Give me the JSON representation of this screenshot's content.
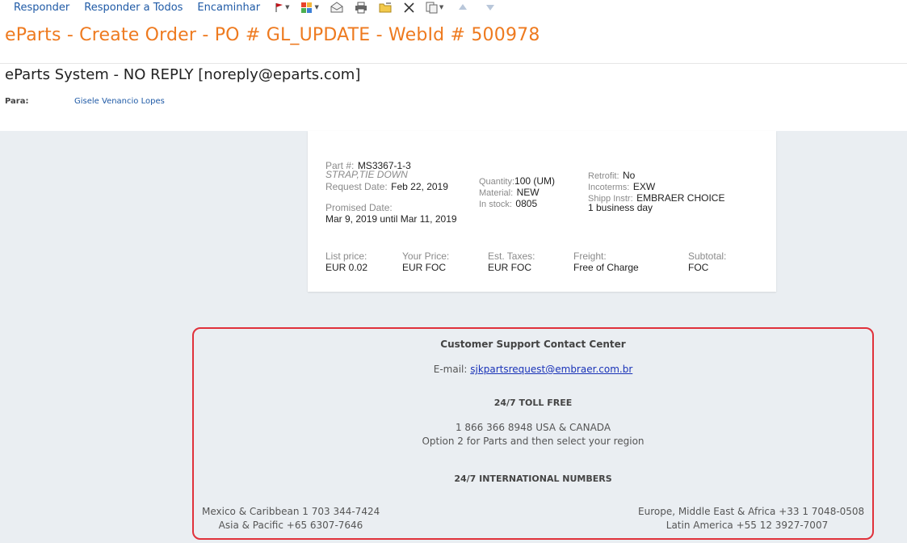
{
  "toolbar": {
    "reply": "Responder",
    "reply_all": "Responder a Todos",
    "forward": "Encaminhar",
    "icons": [
      "flag-icon",
      "categorize-icon",
      "mark-read-icon",
      "print-icon",
      "move-folder-icon",
      "delete-icon",
      "copy-icon",
      "up-arrow-icon",
      "down-arrow-icon"
    ]
  },
  "message": {
    "subject": "eParts - Create Order - PO # GL_UPDATE - WebId # 500978",
    "sender": "eParts System - NO REPLY [noreply@eparts.com]",
    "to_label": "Para:",
    "to_value": "Gisele Venancio Lopes"
  },
  "order": {
    "part_label": "Part #:",
    "part_number": "MS3367-1-3",
    "description": "STRAP,TIE DOWN",
    "request_label": "Request Date:",
    "request_date": "Feb 22, 2019",
    "promised_label": "Promised Date:",
    "promised_date": "Mar 9, 2019 until Mar 11, 2019",
    "quantity_label": "Quantity:",
    "quantity": "100 (UM)",
    "material_label": "Material:",
    "material": "NEW",
    "stock_label": "In stock:",
    "stock": "0805",
    "retrofit_label": "Retrofit:",
    "retrofit": "No",
    "incoterms_label": "Incoterms:",
    "incoterms": "EXW",
    "shipp_label": "Shipp Instr:",
    "shipp": "EMBRAER CHOICE",
    "shipp_extra": "1 business day",
    "list_price_label": "List price:",
    "list_price": "EUR 0.02",
    "your_price_label": "Your Price:",
    "your_price": "EUR FOC",
    "taxes_label": "Est. Taxes:",
    "taxes": "EUR FOC",
    "freight_label": "Freight:",
    "freight": "Free of Charge",
    "subtotal_label": "Subtotal:",
    "subtotal": "FOC"
  },
  "support": {
    "title": "Customer Support Contact Center",
    "email_label": "E-mail:",
    "email": "sjkpartsrequest@embraer.com.br",
    "toll_free_title": "24/7 TOLL FREE",
    "toll_free_number": "1 866 366 8948 USA & CANADA",
    "toll_free_option": "Option 2 for Parts and then select your region",
    "intl_title": "24/7 INTERNATIONAL NUMBERS",
    "mexico": "Mexico & Caribbean 1 703 344-7424",
    "asia": "Asia & Pacific +65 6307-7646",
    "europe": "Europe, Middle East & Africa +33 1 7048-0508",
    "latam": "Latin America +55 12 3927-7007"
  },
  "colors": {
    "subject": "#ee7a1f",
    "link": "#1f5aa6",
    "body_bg": "#eaeef2",
    "highlight_border": "#e0313b"
  }
}
